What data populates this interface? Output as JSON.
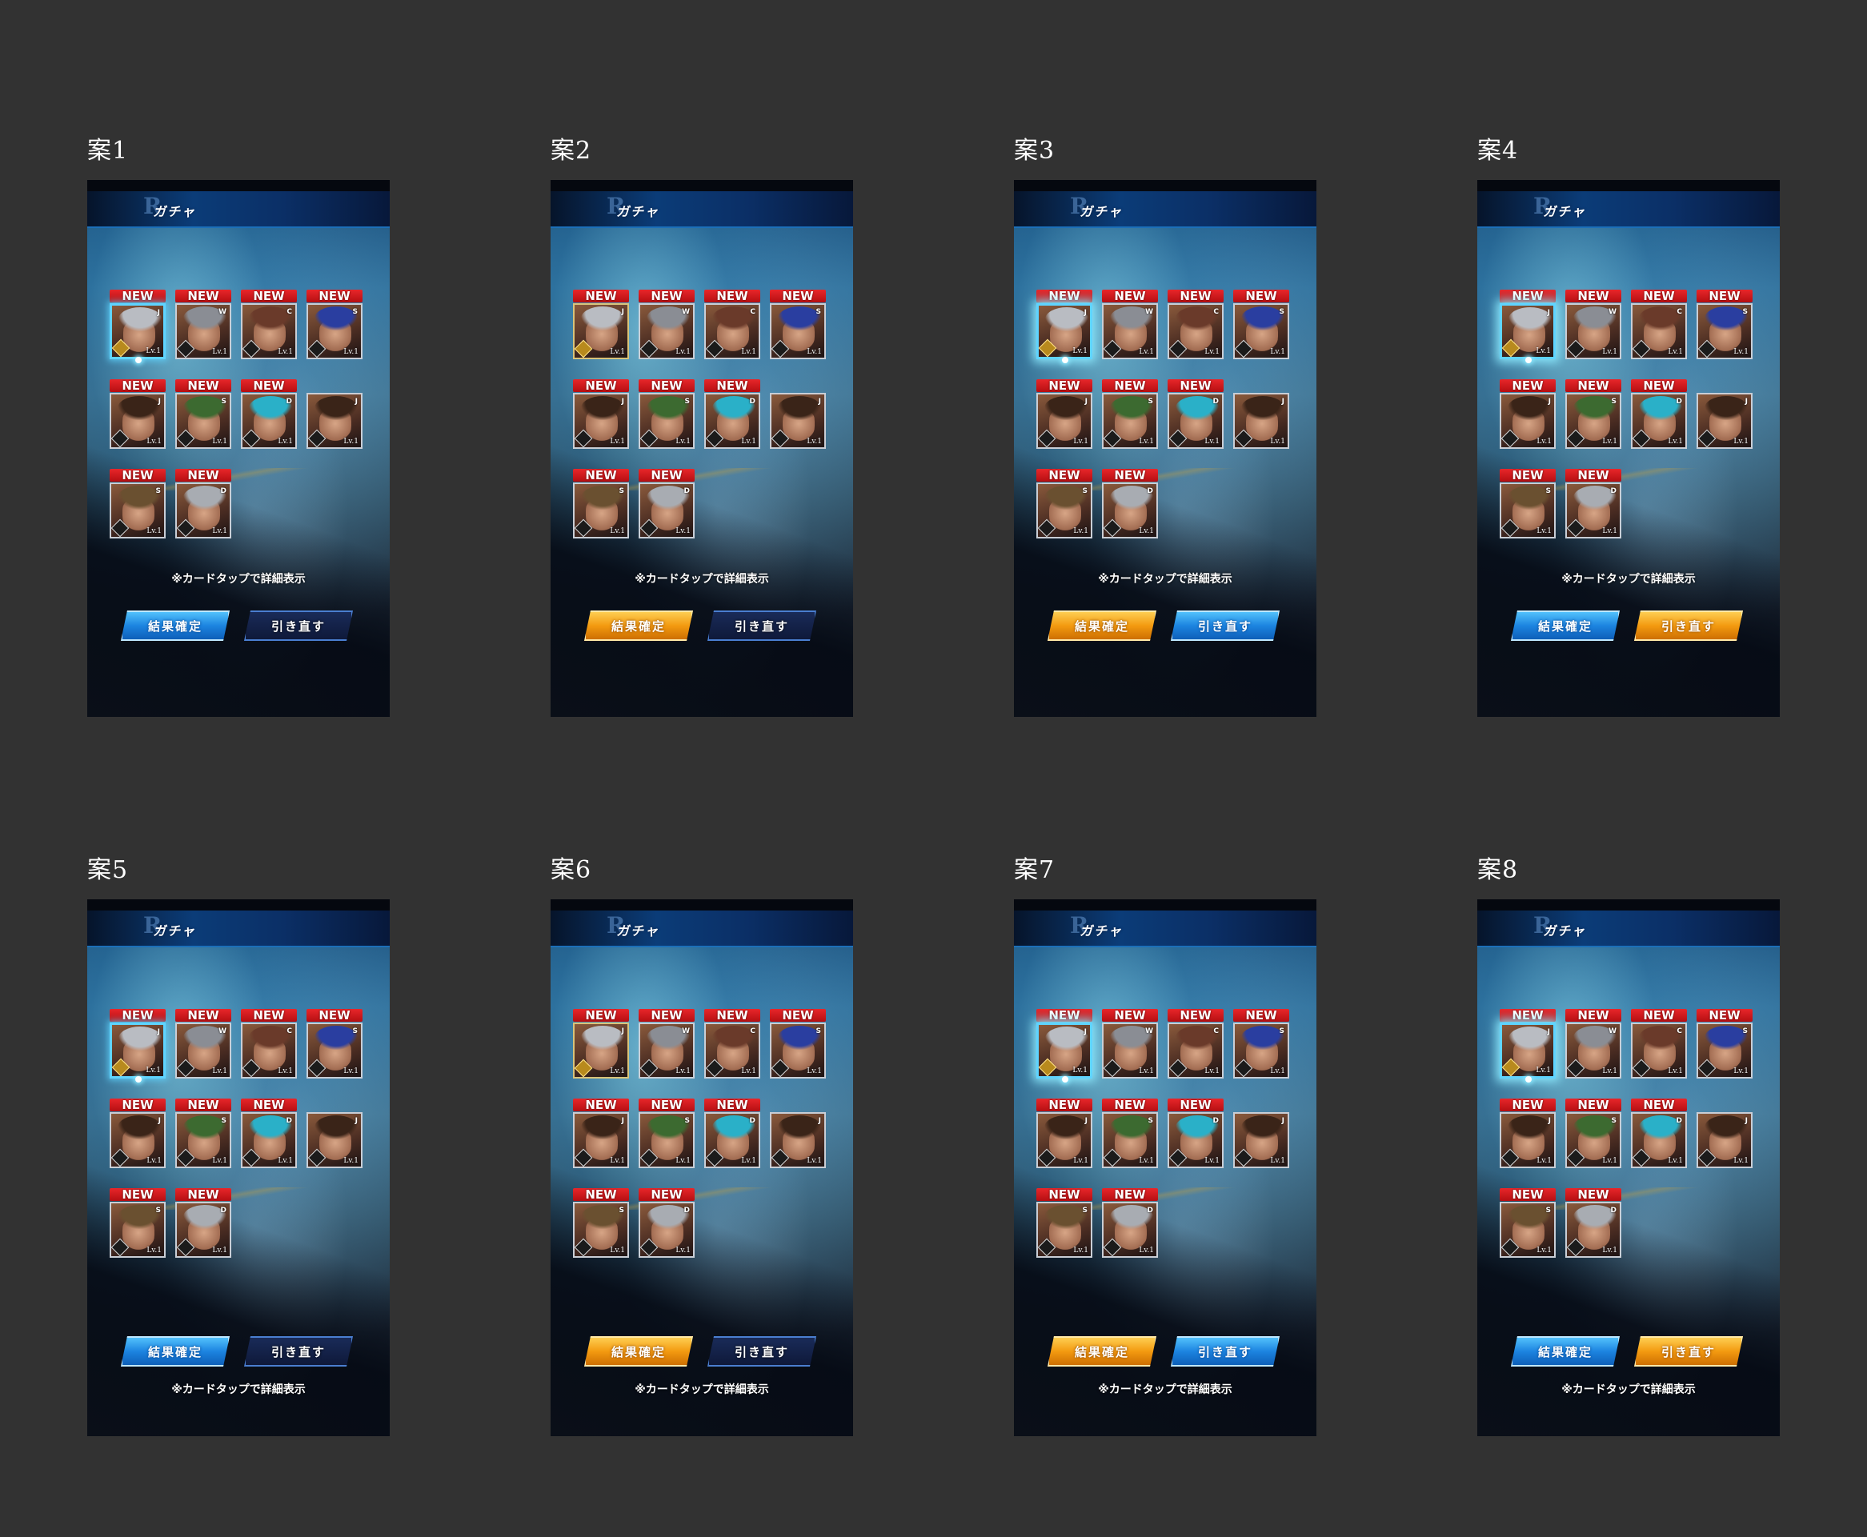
{
  "variants": [
    {
      "label": "案1",
      "title": "ガチャ",
      "logo": "R",
      "hint": "※カードタップで詳細表示",
      "confirm_label": "結果確定",
      "redraw_label": "引き直す",
      "confirm_style": "blue",
      "redraw_style": "dark",
      "hint_position": "above-buttons",
      "selection_glow": "normal"
    },
    {
      "label": "案2",
      "title": "ガチャ",
      "logo": "R",
      "hint": "※カードタップで詳細表示",
      "confirm_label": "結果確定",
      "redraw_label": "引き直す",
      "confirm_style": "orange",
      "redraw_style": "dark",
      "hint_position": "above-buttons",
      "selection_glow": "none"
    },
    {
      "label": "案3",
      "title": "ガチャ",
      "logo": "R",
      "hint": "※カードタップで詳細表示",
      "confirm_label": "結果確定",
      "redraw_label": "引き直す",
      "confirm_style": "orange",
      "redraw_style": "blue",
      "hint_position": "above-buttons",
      "selection_glow": "strong"
    },
    {
      "label": "案4",
      "title": "ガチャ",
      "logo": "R",
      "hint": "※カードタップで詳細表示",
      "confirm_label": "結果確定",
      "redraw_label": "引き直す",
      "confirm_style": "blue",
      "redraw_style": "orange",
      "hint_position": "above-buttons",
      "selection_glow": "strong"
    },
    {
      "label": "案5",
      "title": "ガチャ",
      "logo": "R",
      "hint": "※カードタップで詳細表示",
      "confirm_label": "結果確定",
      "redraw_label": "引き直す",
      "confirm_style": "blue",
      "redraw_style": "dark",
      "hint_position": "below-buttons",
      "selection_glow": "normal"
    },
    {
      "label": "案6",
      "title": "ガチャ",
      "logo": "R",
      "hint": "※カードタップで詳細表示",
      "confirm_label": "結果確定",
      "redraw_label": "引き直す",
      "confirm_style": "orange",
      "redraw_style": "dark",
      "hint_position": "below-buttons",
      "selection_glow": "none"
    },
    {
      "label": "案7",
      "title": "ガチャ",
      "logo": "R",
      "hint": "※カードタップで詳細表示",
      "confirm_label": "結果確定",
      "redraw_label": "引き直す",
      "confirm_style": "orange",
      "redraw_style": "blue",
      "hint_position": "below-buttons",
      "selection_glow": "strong"
    },
    {
      "label": "案8",
      "title": "ガチャ",
      "logo": "R",
      "hint": "※カードタップで詳細表示",
      "confirm_label": "結果確定",
      "redraw_label": "引き直す",
      "confirm_style": "blue",
      "redraw_style": "orange",
      "hint_position": "below-buttons",
      "selection_glow": "strong"
    }
  ],
  "cards": [
    {
      "new": "NEW",
      "level": "Lv.1",
      "attr": "J",
      "hair_color": "#b9bcc2",
      "rarity": "gold",
      "selected": true
    },
    {
      "new": "NEW",
      "level": "Lv.1",
      "attr": "W",
      "hair_color": "#8a8d94",
      "rarity": "silver",
      "selected": false
    },
    {
      "new": "NEW",
      "level": "Lv.1",
      "attr": "C",
      "hair_color": "#6a3a2a",
      "rarity": "silver",
      "selected": false
    },
    {
      "new": "NEW",
      "level": "Lv.1",
      "attr": "S",
      "hair_color": "#2a3ea0",
      "rarity": "silver",
      "selected": false
    },
    {
      "new": "NEW",
      "level": "Lv.1",
      "attr": "J",
      "hair_color": "#3a2418",
      "rarity": "silver",
      "selected": false
    },
    {
      "new": "NEW",
      "level": "Lv.1",
      "attr": "S",
      "hair_color": "#3c6a30",
      "rarity": "silver",
      "selected": false
    },
    {
      "new": "NEW",
      "level": "Lv.1",
      "attr": "D",
      "hair_color": "#2ab0c8",
      "rarity": "silver",
      "selected": false
    },
    {
      "new": "",
      "level": "Lv.1",
      "attr": "J",
      "hair_color": "#3a2418",
      "rarity": "silver",
      "selected": false
    },
    {
      "new": "NEW",
      "level": "Lv.1",
      "attr": "S",
      "hair_color": "#6a5030",
      "rarity": "silver",
      "selected": false
    },
    {
      "new": "NEW",
      "level": "Lv.1",
      "attr": "D",
      "hair_color": "#a8acb2",
      "rarity": "silver",
      "selected": false
    }
  ]
}
